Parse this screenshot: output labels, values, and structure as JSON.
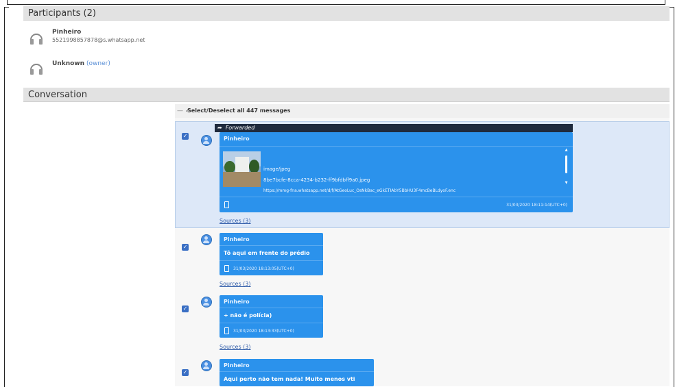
{
  "participants_section": {
    "title": "Participants (2)",
    "items": [
      {
        "name": "Pinheiro",
        "id": "5521998857878@s.whatsapp.net",
        "owner_tag": ""
      },
      {
        "name": "Unknown",
        "id": "",
        "owner_tag": "(owner)"
      }
    ]
  },
  "conversation_section": {
    "title": "Conversation",
    "select_all_label": "Select/Deselect all 447 messages",
    "messages": [
      {
        "forwarded_label": "Forwarded",
        "sender": "Pinheiro",
        "attachment": {
          "mime": "image/jpeg",
          "file": "8be7bcfe-8cca-4234-b232-ff9bfdbff9a0.jpeg",
          "url": "https://mmg-fna.whatsapp.net/d/f/AtGeoLuc_OsNkBac_eGkETIAbY5BbHU3F4mcBeBLdyoF.enc"
        },
        "timestamp": "31/03/2020 18:11:14(UTC+0)",
        "sources_label": "Sources (3)"
      },
      {
        "sender": "Pinheiro",
        "text": "Tô aqui em frente do prédio",
        "timestamp": "31/03/2020 18:13:05(UTC+0)",
        "sources_label": "Sources (3)"
      },
      {
        "sender": "Pinheiro",
        "text": "+ não é polícia)",
        "timestamp": "31/03/2020 18:13:33(UTC+0)",
        "sources_label": "Sources (3)"
      },
      {
        "sender": "Pinheiro",
        "text": "Aqui perto não tem nada! Muito menos vti",
        "timestamp": "",
        "sources_label": ""
      }
    ]
  }
}
